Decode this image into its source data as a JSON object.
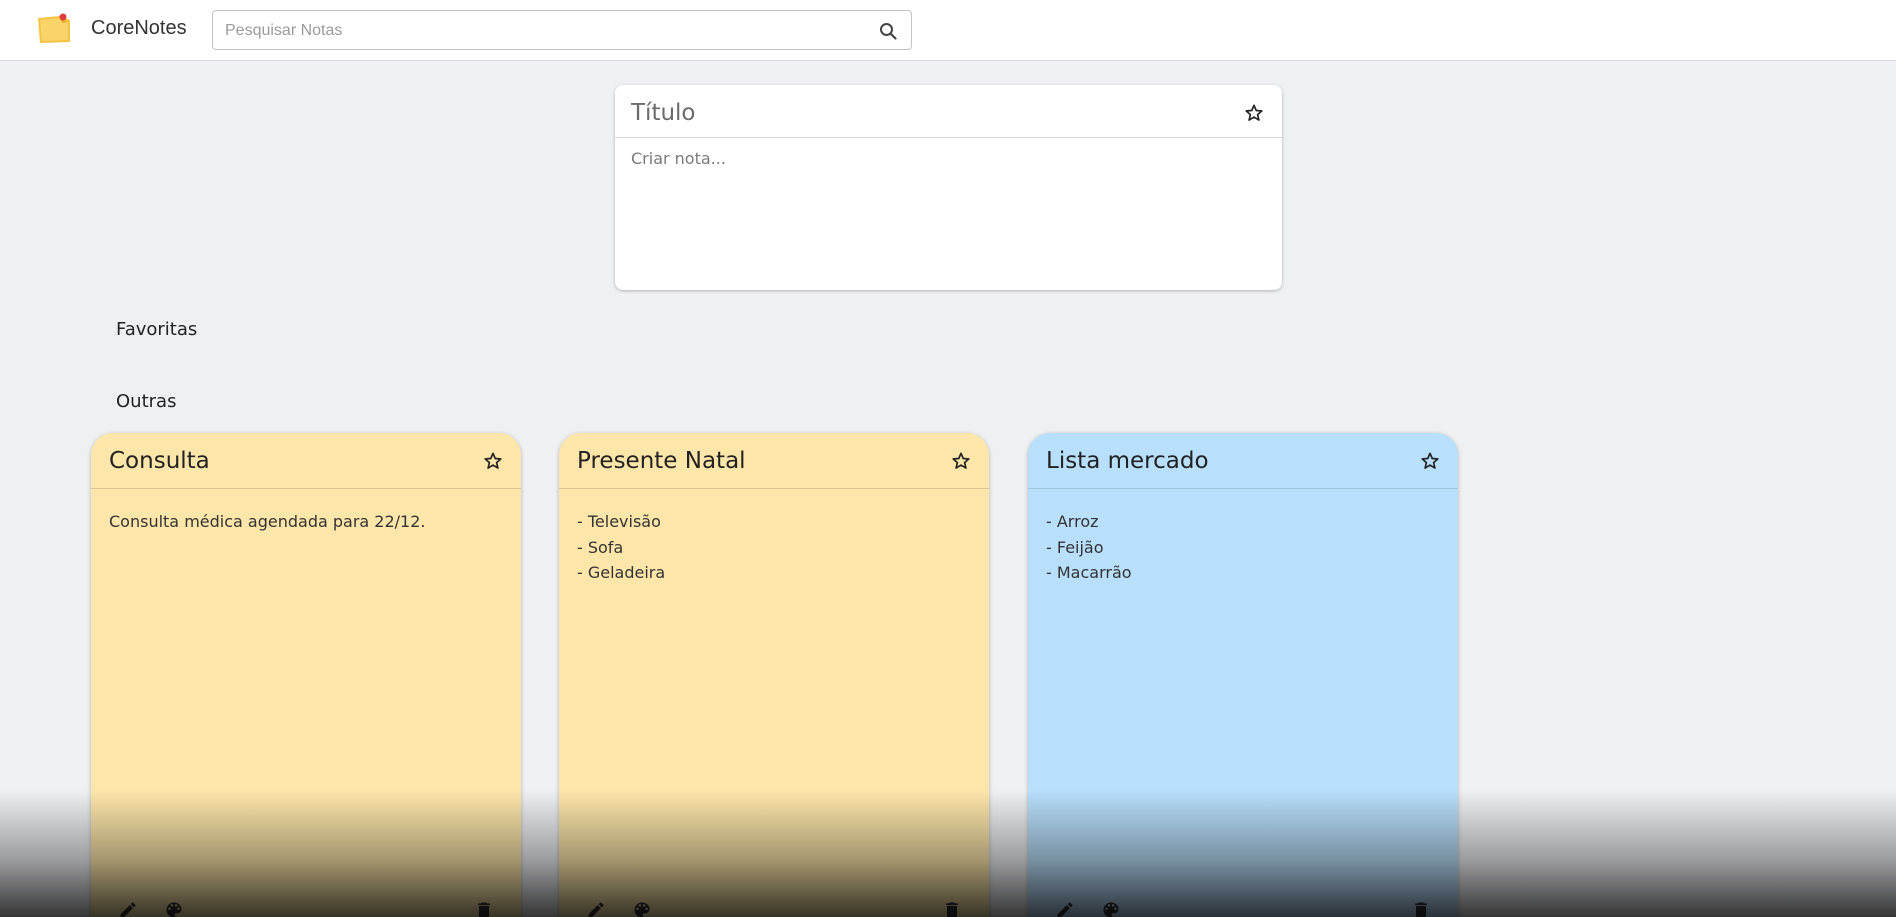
{
  "header": {
    "app_name": "CoreNotes",
    "logo_icon": "sticky-note-icon",
    "search": {
      "placeholder": "Pesquisar Notas",
      "value": "",
      "icon": "search-icon"
    }
  },
  "create_note": {
    "title_placeholder": "Título",
    "body_placeholder": "Criar nota...",
    "favorite_icon": "star-outline-icon"
  },
  "sections": {
    "favorites_label": "Favoritas",
    "others_label": "Outras"
  },
  "notes": [
    {
      "title": "Consulta",
      "lines": [
        "Consulta médica agendada para 22/12."
      ],
      "color": "#fde6aa",
      "favorite": false
    },
    {
      "title": "Presente Natal",
      "lines": [
        "- Televisão",
        "- Sofa",
        "- Geladeira"
      ],
      "color": "#fde6aa",
      "favorite": false
    },
    {
      "title": "Lista mercado",
      "lines": [
        "- Arroz",
        "- Feijão",
        "- Macarrão"
      ],
      "color": "#b8dffb",
      "favorite": false
    }
  ],
  "note_actions": {
    "edit_icon": "pencil-icon",
    "color_icon": "palette-icon",
    "delete_icon": "trash-icon"
  }
}
